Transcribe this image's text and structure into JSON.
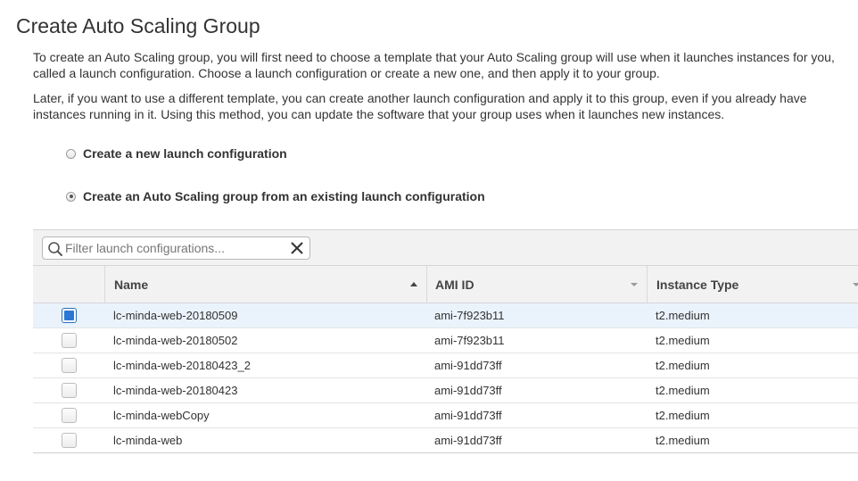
{
  "page": {
    "title": "Create Auto Scaling Group",
    "intro_paragraph": "To create an Auto Scaling group, you will first need to choose a template that your Auto Scaling group will use when it launches instances for you, called a launch configuration. Choose a launch configuration or create a new one, and then apply it to your group.",
    "later_paragraph": "Later, if you want to use a different template, you can create another launch configuration and apply it to this group, even if you already have instances running in it. Using this method, you can update the software that your group uses when it launches new instances."
  },
  "options": {
    "new_config_label": "Create a new launch configuration",
    "existing_config_label": "Create an Auto Scaling group from an existing launch configuration",
    "selected": "existing"
  },
  "filter": {
    "placeholder": "Filter launch configurations...",
    "value": ""
  },
  "table": {
    "columns": {
      "name": "Name",
      "ami_id": "AMI ID",
      "instance_type": "Instance Type"
    },
    "sort": {
      "column": "name",
      "direction": "ascending"
    },
    "rows": [
      {
        "name": "lc-minda-web-20180509",
        "ami_id": "ami-7f923b11",
        "instance_type": "t2.medium",
        "selected": true
      },
      {
        "name": "lc-minda-web-20180502",
        "ami_id": "ami-7f923b11",
        "instance_type": "t2.medium",
        "selected": false
      },
      {
        "name": "lc-minda-web-20180423_2",
        "ami_id": "ami-91dd73ff",
        "instance_type": "t2.medium",
        "selected": false
      },
      {
        "name": "lc-minda-web-20180423",
        "ami_id": "ami-91dd73ff",
        "instance_type": "t2.medium",
        "selected": false
      },
      {
        "name": "lc-minda-webCopy",
        "ami_id": "ami-91dd73ff",
        "instance_type": "t2.medium",
        "selected": false
      },
      {
        "name": "lc-minda-web",
        "ami_id": "ami-91dd73ff",
        "instance_type": "t2.medium",
        "selected": false
      }
    ]
  },
  "colors": {
    "selected_row_bg": "#eaf3fc",
    "checkbox_accent": "#2b78d4",
    "header_bg": "#f2f2f2"
  },
  "icons": {
    "search": "search-icon",
    "clear": "close-icon",
    "sort_ascending": "sort-ascending-icon",
    "sort_dropdown": "chevron-down-icon"
  }
}
